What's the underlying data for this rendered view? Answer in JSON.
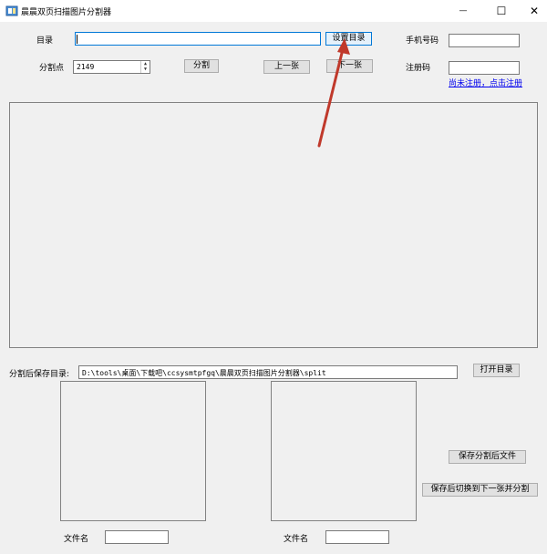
{
  "window": {
    "title": "晨晨双页扫描图片分割器",
    "minimize_glyph": "—",
    "maximize_glyph": "☐",
    "close_glyph": "✕"
  },
  "top": {
    "dir_label": "目录",
    "dir_value": "",
    "set_dir_button": "设置目录",
    "phone_label": "手机号码",
    "phone_value": "",
    "split_point_label": "分割点",
    "split_point_value": "2149",
    "split_button": "分割",
    "prev_button": "上一张",
    "next_button": "下一张",
    "reg_code_label": "注册码",
    "reg_code_value": "",
    "register_link": "尚未注册，点击注册"
  },
  "save": {
    "save_dir_label": "分割后保存目录:",
    "save_dir_value": "D:\\tools\\桌面\\下载吧\\ccsysmtpfgq\\晨晨双页扫描图片分割器\\split",
    "open_dir_button": "打开目录",
    "save_files_button": "保存分割后文件",
    "save_next_button": "保存后切换到下一张并分割",
    "filename_label_left": "文件名",
    "filename_label_right": "文件名",
    "filename_left_value": "",
    "filename_right_value": ""
  },
  "colors": {
    "accent": "#0078d7",
    "arrow": "#c0392b"
  },
  "icons": {
    "app": "app-icon",
    "minimize": "minimize-icon",
    "maximize": "maximize-icon",
    "close": "close-icon",
    "spinner_up": "spinner-up-icon",
    "spinner_down": "spinner-down-icon"
  }
}
